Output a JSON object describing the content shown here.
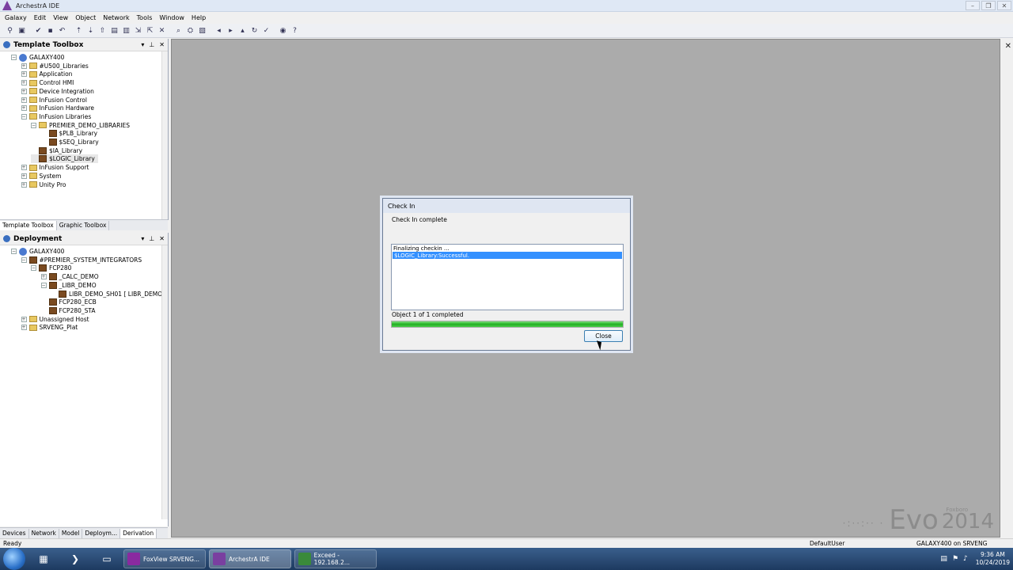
{
  "window": {
    "title": "ArchestrA IDE",
    "controls": [
      "–",
      "❐",
      "✕"
    ]
  },
  "menu": [
    "Galaxy",
    "Edit",
    "View",
    "Object",
    "Network",
    "Tools",
    "Window",
    "Help"
  ],
  "toolbar_icons": [
    "pin-icon",
    "properties-icon",
    "checkin-icon",
    "save-icon",
    "undo-icon",
    "deploy-icon",
    "undeploy-icon",
    "upload-icon",
    "template-icon",
    "instance-icon",
    "import-icon",
    "export-icon",
    "delete-icon",
    "find-icon",
    "network-icon",
    "graphics-icon",
    "nav-back-icon",
    "nav-forward-icon",
    "nav-up-icon",
    "refresh-icon",
    "check-icon",
    "browser-icon",
    "help-icon"
  ],
  "template_toolbox": {
    "title": "Template Toolbox",
    "tree": [
      {
        "label": "GALAXY400",
        "indent": 0,
        "kind": "galaxy",
        "exp": "−"
      },
      {
        "label": "#U500_Libraries",
        "indent": 1,
        "kind": "folder",
        "exp": "+"
      },
      {
        "label": "Application",
        "indent": 1,
        "kind": "folder",
        "exp": "+"
      },
      {
        "label": "Control HMI",
        "indent": 1,
        "kind": "folder",
        "exp": "+"
      },
      {
        "label": "Device Integration",
        "indent": 1,
        "kind": "folder",
        "exp": "+"
      },
      {
        "label": "InFusion Control",
        "indent": 1,
        "kind": "folder",
        "exp": "+"
      },
      {
        "label": "InFusion Hardware",
        "indent": 1,
        "kind": "folder",
        "exp": "+"
      },
      {
        "label": "InFusion Libraries",
        "indent": 1,
        "kind": "folder",
        "exp": "−"
      },
      {
        "label": "PREMIER_DEMO_LIBRARIES",
        "indent": 2,
        "kind": "folder",
        "exp": "−"
      },
      {
        "label": "$PLB_Library",
        "indent": 3,
        "kind": "obj",
        "exp": ""
      },
      {
        "label": "$SEQ_Library",
        "indent": 3,
        "kind": "obj",
        "exp": ""
      },
      {
        "label": "$IA_Library",
        "indent": 2,
        "kind": "obj",
        "exp": ""
      },
      {
        "label": "$LOGIC_Library",
        "indent": 2,
        "kind": "obj",
        "exp": "",
        "selected": true
      },
      {
        "label": "InFusion Support",
        "indent": 1,
        "kind": "folder",
        "exp": "+"
      },
      {
        "label": "System",
        "indent": 1,
        "kind": "folder",
        "exp": "+"
      },
      {
        "label": "Unity Pro",
        "indent": 1,
        "kind": "folder",
        "exp": "+"
      }
    ],
    "tabs": [
      "Template Toolbox",
      "Graphic Toolbox"
    ]
  },
  "deployment": {
    "title": "Deployment",
    "tree": [
      {
        "label": "GALAXY400",
        "indent": 0,
        "kind": "galaxy",
        "exp": "−"
      },
      {
        "label": "#PREMIER_SYSTEM_INTEGRATORS",
        "indent": 1,
        "kind": "obj",
        "exp": "−"
      },
      {
        "label": "FCP280",
        "indent": 2,
        "kind": "obj",
        "exp": "−"
      },
      {
        "label": "_CALC_DEMO",
        "indent": 3,
        "kind": "obj",
        "exp": "+"
      },
      {
        "label": "_LIBR_DEMO",
        "indent": 3,
        "kind": "obj",
        "exp": "−"
      },
      {
        "label": "LIBR_DEMO_SH01 [ LIBR_DEMO_",
        "indent": 4,
        "kind": "obj",
        "exp": ""
      },
      {
        "label": "FCP280_ECB",
        "indent": 3,
        "kind": "obj",
        "exp": ""
      },
      {
        "label": "FCP280_STA",
        "indent": 3,
        "kind": "obj",
        "exp": ""
      },
      {
        "label": "Unassigned Host",
        "indent": 1,
        "kind": "folder",
        "exp": "+"
      },
      {
        "label": "SRVENG_Plat",
        "indent": 1,
        "kind": "folder",
        "exp": "+"
      }
    ],
    "tabs": [
      "Devices",
      "Network",
      "Model",
      "Deploym...",
      "Derivation"
    ]
  },
  "dialog": {
    "title": "Check In",
    "message": "Check In complete",
    "list": [
      "Finalizing checkin ...",
      "$LOGIC_Library:Successful."
    ],
    "status": "Object 1 of 1 completed",
    "progress": 1.0,
    "close_label": "Close"
  },
  "watermark": {
    "brand": "Foxboro",
    "product": "Evo",
    "year": "2014",
    "dots": "·:··:·· ·"
  },
  "statusbar": {
    "ready": "Ready",
    "user": "DefaultUser",
    "node": "GALAXY400 on SRVENG"
  },
  "taskbar": {
    "apps": [
      {
        "label": "FoxView SRVENG...",
        "color": "#8a2aa0"
      },
      {
        "label": "ArchestrA IDE",
        "color": "#7a3fa0",
        "active": true
      },
      {
        "label": "Exceed - 192.168.2...",
        "color": "#3a8a3a"
      }
    ],
    "time": "9:36 AM",
    "date": "10/24/2019"
  }
}
